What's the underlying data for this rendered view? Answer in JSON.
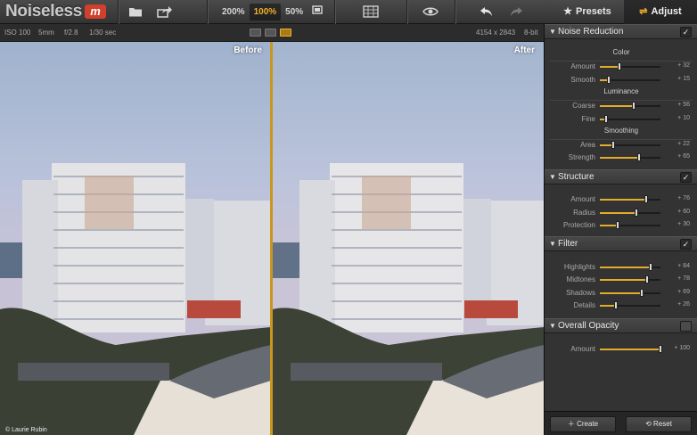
{
  "app": {
    "title": "Noiseless",
    "logo_letter": "m"
  },
  "toolbar": {
    "zoom_options": [
      "200%",
      "100%",
      "50%"
    ],
    "zoom_active": "100%",
    "icons": [
      "folder-icon",
      "share-icon",
      "fit-screen-icon",
      "compare-grid-icon",
      "eye-icon",
      "undo-icon",
      "redo-icon"
    ]
  },
  "tabs": [
    {
      "label": "Presets",
      "icon": "star-icon",
      "glyph": "★"
    },
    {
      "label": "Adjust",
      "icon": "sliders-icon",
      "glyph": "⇌"
    }
  ],
  "info": {
    "iso": "ISO 100",
    "focal": "5mm",
    "aperture": "f/2.8",
    "shutter": "1/30 sec",
    "dimensions": "4154 x 2843",
    "bitdepth": "8-bit"
  },
  "viewer": {
    "before_label": "Before",
    "after_label": "After",
    "credit": "© Laurie Rubin"
  },
  "sections": {
    "noise_reduction": {
      "title": "Noise Reduction",
      "enabled": true,
      "groups": [
        {
          "label": "Color",
          "rows": [
            {
              "label": "Amount",
              "value": "+ 32",
              "level": 0.32
            },
            {
              "label": "Smooth",
              "value": "+ 15",
              "level": 0.15
            }
          ]
        },
        {
          "label": "Luminance",
          "rows": [
            {
              "label": "Coarse",
              "value": "+ 56",
              "level": 0.56
            },
            {
              "label": "Fine",
              "value": "+ 10",
              "level": 0.1
            }
          ]
        },
        {
          "label": "Smoothing",
          "rows": [
            {
              "label": "Area",
              "value": "+ 22",
              "level": 0.22
            },
            {
              "label": "Strength",
              "value": "+ 65",
              "level": 0.65
            }
          ]
        }
      ]
    },
    "structure": {
      "title": "Structure",
      "enabled": true,
      "rows": [
        {
          "label": "Amount",
          "value": "+ 76",
          "level": 0.76
        },
        {
          "label": "Radius",
          "value": "+ 60",
          "level": 0.6
        },
        {
          "label": "Protection",
          "value": "+ 30",
          "level": 0.3
        }
      ]
    },
    "filter": {
      "title": "Filter",
      "enabled": true,
      "rows": [
        {
          "label": "Highlights",
          "value": "+ 84",
          "level": 0.84
        },
        {
          "label": "Midtones",
          "value": "+ 78",
          "level": 0.78
        },
        {
          "label": "Shadows",
          "value": "+ 69",
          "level": 0.69
        },
        {
          "label": "Details",
          "value": "+ 26",
          "level": 0.26
        }
      ]
    },
    "overall_opacity": {
      "title": "Overall Opacity",
      "enabled": false,
      "rows": [
        {
          "label": "Amount",
          "value": "+ 100",
          "level": 1.0
        }
      ]
    }
  },
  "buttons": {
    "create": "Create",
    "reset": "Reset"
  },
  "colors": {
    "accent": "#f0b02b",
    "panel": "#333333",
    "toolbar": "#3a3a3a"
  }
}
